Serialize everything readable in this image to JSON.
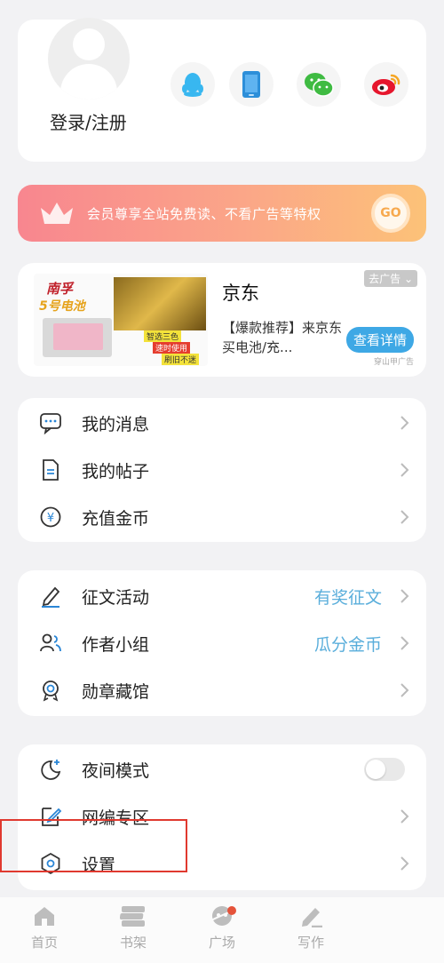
{
  "profile": {
    "login_label": "登录/注册",
    "social": [
      "qq-icon",
      "phone-icon",
      "wechat-icon",
      "weibo-icon"
    ]
  },
  "vip_banner": {
    "text": "会员尊享全站免费读、不看广告等特权",
    "go_label": "GO",
    "colors": [
      "#f8868f",
      "#fcc278"
    ]
  },
  "ad": {
    "title": "京东",
    "description": "【爆款推荐】来京东买电池/充...",
    "close_label": "去广告",
    "button_label": "查看详情",
    "source_label": "穿山甲广告",
    "image_brand": "南孚",
    "image_product": "5号电池",
    "image_tags": [
      "智选三色",
      "速时使用",
      "刷旧不迷"
    ]
  },
  "menu1": [
    {
      "label": "我的消息",
      "icon": "message-icon"
    },
    {
      "label": "我的帖子",
      "icon": "document-icon"
    },
    {
      "label": "充值金币",
      "icon": "coin-icon"
    }
  ],
  "menu2": [
    {
      "label": "征文活动",
      "extra": "有奖征文",
      "icon": "pen-icon"
    },
    {
      "label": "作者小组",
      "extra": "瓜分金币",
      "icon": "group-icon"
    },
    {
      "label": "勋章藏馆",
      "icon": "medal-icon"
    }
  ],
  "menu3": [
    {
      "label": "夜间模式",
      "icon": "moon-icon",
      "toggle": false
    },
    {
      "label": "网编专区",
      "icon": "edit-icon"
    },
    {
      "label": "设置",
      "icon": "settings-icon"
    }
  ],
  "tabs": [
    {
      "label": "首页",
      "icon": "home-icon"
    },
    {
      "label": "书架",
      "icon": "bookshelf-icon"
    },
    {
      "label": "广场",
      "icon": "plaza-icon",
      "badge": true
    },
    {
      "label": "写作",
      "icon": "write-icon"
    }
  ],
  "accent_color": "#5aaedb"
}
